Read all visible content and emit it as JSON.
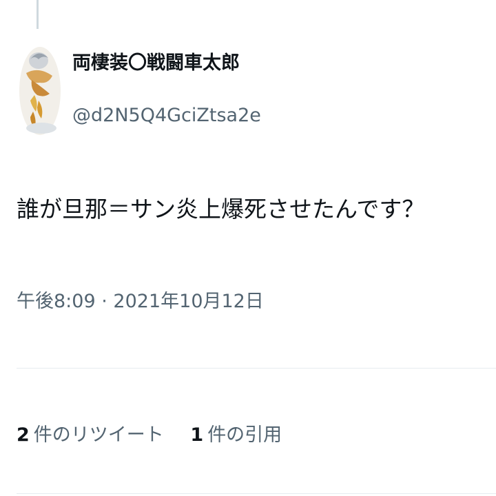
{
  "tweet": {
    "author": {
      "display_name": "両棲装〇戦闘車太郎",
      "handle": "@d2N5Q4GciZtsa2e",
      "avatar_icon": "avatar-icon"
    },
    "text": "誰が旦那＝サン炎上爆死させたんです？",
    "time": "午後8:09",
    "separator": "·",
    "date": "2021年10月12日",
    "stats": [
      {
        "count": "2",
        "label": "件のリツイート"
      },
      {
        "count": "1",
        "label": "件の引用"
      }
    ]
  },
  "colors": {
    "primary_text": "#0f1419",
    "secondary_text": "#536471",
    "divider": "#e6ecf0"
  }
}
